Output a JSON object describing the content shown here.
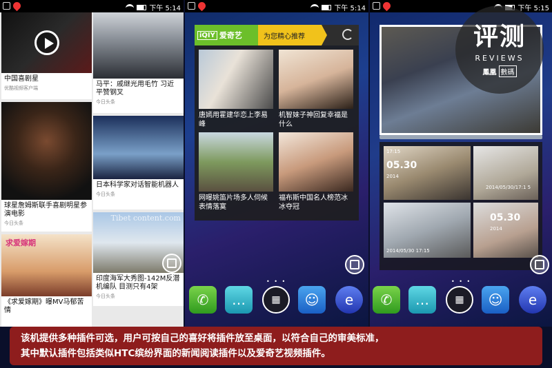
{
  "phones": [
    {
      "status_time": "下午 5:14"
    },
    {
      "status_time": "下午 5:14"
    },
    {
      "status_time": "下午 5:15"
    }
  ],
  "news": {
    "left": [
      {
        "title": "中国喜剧星",
        "source": "优酷视频客户端",
        "icon": "play-icon"
      },
      {
        "title": "球星詹姆斯联手喜剧明星参演电影",
        "source": "今日头条"
      },
      {
        "title": "《求爱嫁期》曝MV马郁苦情",
        "source": "",
        "overlay": "求爱嫁期"
      }
    ],
    "right": [
      {
        "title": "马平：戚继光用毛竹 习近平赞钢叉",
        "source": "今日头条"
      },
      {
        "title": "日本科学家对话智能机器人",
        "source": "今日头条"
      },
      {
        "title": "印度海军大秀图-142M反潜机编队 目测只有4架",
        "source": "今日头条",
        "watermark": "Tibet content.com"
      }
    ]
  },
  "iqiyi": {
    "logo_box": "iQIY",
    "logo_text": "爱奇艺",
    "tagline": "为您精心推荐",
    "items": [
      {
        "caption": "唐嫣用霍建华恋上李易峰"
      },
      {
        "caption": "机智妹子神回复幸福是什么"
      },
      {
        "caption": "网曝姚笛片场多人伺候表情落寞"
      },
      {
        "caption": "福布斯中国名人榜范冰冰夺冠"
      }
    ]
  },
  "gallery": {
    "tiles": [
      {
        "clock": "17:15",
        "date": "05.30",
        "year": "2014"
      },
      {
        "caption": "2014/05/30/17:1 5"
      },
      {
        "caption": "2014/05/30 17:15"
      },
      {
        "date": "05.30",
        "year": "2014"
      }
    ]
  },
  "reviews": {
    "main": "评测",
    "en": "REVIEWS",
    "cn": "鳳凰",
    "cn_box": "數碼"
  },
  "dock": {
    "icons": [
      "phone-icon",
      "message-icon",
      "apps-icon",
      "contacts-icon",
      "browser-icon"
    ]
  },
  "page_dots": "• • •",
  "caption": {
    "line1": "该机提供多种插件可选，用户可按自己的喜好将插件放至桌面，以符合自己的审美标准，",
    "line2": "其中默认插件包括类似HTC缤纷界面的新闻阅读插件以及爱奇艺视频插件。"
  }
}
